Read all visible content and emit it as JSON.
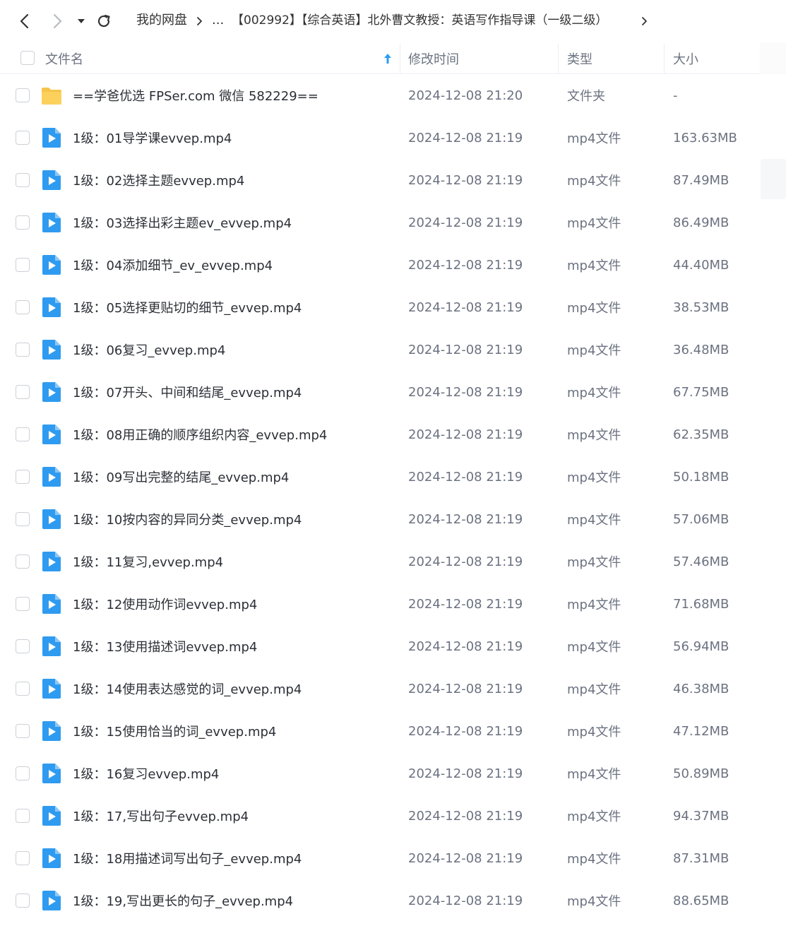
{
  "toolbar": {
    "back_icon": "chevron-left-icon",
    "forward_icon": "chevron-right-icon",
    "dropdown_icon": "caret-down-icon",
    "refresh_icon": "refresh-icon",
    "breadcrumb": {
      "root": "我的网盘",
      "ellipsis": "...",
      "current": "【002992】【综合英语】北外曹文教授：英语写作指导课（一级二级）"
    }
  },
  "header": {
    "name": "文件名",
    "sort_icon": "arrow-up-icon",
    "time": "修改时间",
    "type": "类型",
    "size": "大小"
  },
  "colors": {
    "folder": "#f7c44a",
    "video": "#2f9bf0",
    "sort_arrow": "#2e9cf0"
  },
  "files": [
    {
      "name": "==学爸优选 FPSer.com 微信 582229==",
      "time": "2024-12-08 21:20",
      "type": "文件夹",
      "size": "-",
      "icon": "folder-icon"
    },
    {
      "name": "1级：01导学课evvep.mp4",
      "time": "2024-12-08 21:19",
      "type": "mp4文件",
      "size": "163.63MB",
      "icon": "video-file-icon"
    },
    {
      "name": "1级：02选择主题evvep.mp4",
      "time": "2024-12-08 21:19",
      "type": "mp4文件",
      "size": "87.49MB",
      "icon": "video-file-icon"
    },
    {
      "name": "1级：03选择出彩主题ev_evvep.mp4",
      "time": "2024-12-08 21:19",
      "type": "mp4文件",
      "size": "86.49MB",
      "icon": "video-file-icon"
    },
    {
      "name": "1级：04添加细节_ev_evvep.mp4",
      "time": "2024-12-08 21:19",
      "type": "mp4文件",
      "size": "44.40MB",
      "icon": "video-file-icon"
    },
    {
      "name": "1级：05选择更贴切的细节_evvep.mp4",
      "time": "2024-12-08 21:19",
      "type": "mp4文件",
      "size": "38.53MB",
      "icon": "video-file-icon"
    },
    {
      "name": "1级：06复习_evvep.mp4",
      "time": "2024-12-08 21:19",
      "type": "mp4文件",
      "size": "36.48MB",
      "icon": "video-file-icon"
    },
    {
      "name": "1级：07开头、中间和结尾_evvep.mp4",
      "time": "2024-12-08 21:19",
      "type": "mp4文件",
      "size": "67.75MB",
      "icon": "video-file-icon"
    },
    {
      "name": "1级：08用正确的顺序组织内容_evvep.mp4",
      "time": "2024-12-08 21:19",
      "type": "mp4文件",
      "size": "62.35MB",
      "icon": "video-file-icon"
    },
    {
      "name": "1级：09写出完整的结尾_evvep.mp4",
      "time": "2024-12-08 21:19",
      "type": "mp4文件",
      "size": "50.18MB",
      "icon": "video-file-icon"
    },
    {
      "name": "1级：10按内容的异同分类_evvep.mp4",
      "time": "2024-12-08 21:19",
      "type": "mp4文件",
      "size": "57.06MB",
      "icon": "video-file-icon"
    },
    {
      "name": "1级：11复习,evvep.mp4",
      "time": "2024-12-08 21:19",
      "type": "mp4文件",
      "size": "57.46MB",
      "icon": "video-file-icon"
    },
    {
      "name": "1级：12使用动作词evvep.mp4",
      "time": "2024-12-08 21:19",
      "type": "mp4文件",
      "size": "71.68MB",
      "icon": "video-file-icon"
    },
    {
      "name": "1级：13使用描述词evvep.mp4",
      "time": "2024-12-08 21:19",
      "type": "mp4文件",
      "size": "56.94MB",
      "icon": "video-file-icon"
    },
    {
      "name": "1级：14使用表达感觉的词_evvep.mp4",
      "time": "2024-12-08 21:19",
      "type": "mp4文件",
      "size": "46.38MB",
      "icon": "video-file-icon"
    },
    {
      "name": "1级：15使用恰当的词_evvep.mp4",
      "time": "2024-12-08 21:19",
      "type": "mp4文件",
      "size": "47.12MB",
      "icon": "video-file-icon"
    },
    {
      "name": "1级：16复习evvep.mp4",
      "time": "2024-12-08 21:19",
      "type": "mp4文件",
      "size": "50.89MB",
      "icon": "video-file-icon"
    },
    {
      "name": "1级：17,写出句子evvep.mp4",
      "time": "2024-12-08 21:19",
      "type": "mp4文件",
      "size": "94.37MB",
      "icon": "video-file-icon"
    },
    {
      "name": "1级：18用描述词写出句子_evvep.mp4",
      "time": "2024-12-08 21:19",
      "type": "mp4文件",
      "size": "87.31MB",
      "icon": "video-file-icon"
    },
    {
      "name": "1级：19,写出更长的句子_evvep.mp4",
      "time": "2024-12-08 21:19",
      "type": "mp4文件",
      "size": "88.65MB",
      "icon": "video-file-icon"
    }
  ]
}
